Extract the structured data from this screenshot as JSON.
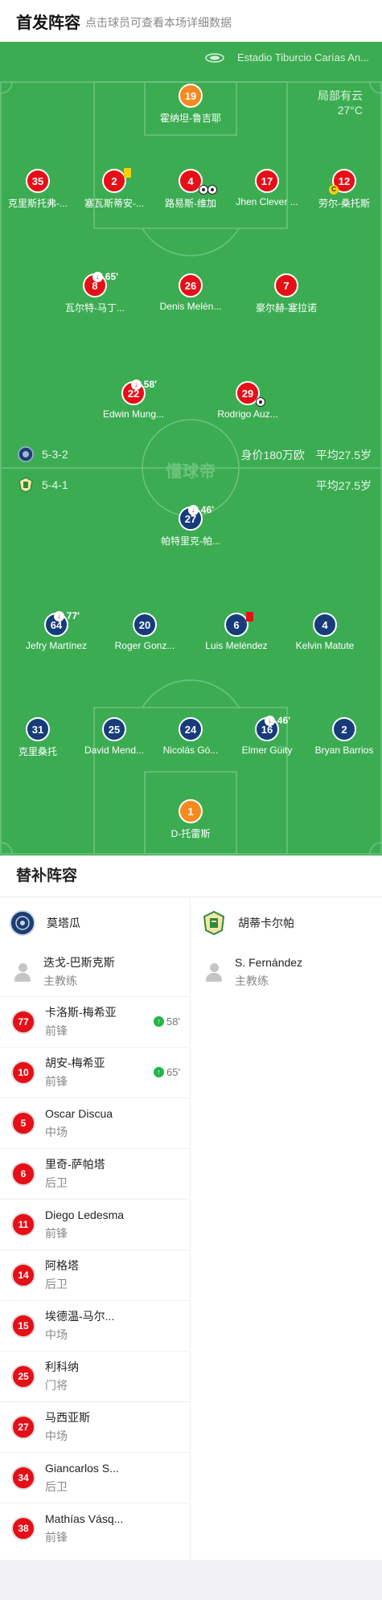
{
  "header": {
    "title": "首发阵容",
    "subtitle": "点击球员可查看本场详细数据"
  },
  "pitch": {
    "stadium": "Estadio Tiburcio Carías An...",
    "weather": "局部有云",
    "temperature": "27°C",
    "watermark": "懂球帝",
    "home_team": {
      "formation": "5-3-2",
      "value": "身价180万欧",
      "avg_age": "平均27.5岁",
      "crest_color": "#1d3e73"
    },
    "away_team": {
      "formation": "5-4-1",
      "avg_age": "平均27.5岁",
      "crest_color": "#2e8b3a"
    },
    "home_players": [
      {
        "num": "19",
        "name": "霍纳坦-鲁吉耶",
        "gk": true
      },
      {
        "num": "35",
        "name": "克里斯托弗-..."
      },
      {
        "num": "2",
        "name": "塞瓦斯蒂安-..."
      },
      {
        "num": "4",
        "name": "路易斯-维加"
      },
      {
        "num": "17",
        "name": "Jhen Clever ..."
      },
      {
        "num": "12",
        "name": "劳尔-桑托斯"
      },
      {
        "num": "8",
        "name": "瓦尔特-马丁...",
        "sub": "65'"
      },
      {
        "num": "26",
        "name": "Denis Melén..."
      },
      {
        "num": "7",
        "name": "豪尔赫-塞拉诺"
      },
      {
        "num": "22",
        "name": "Edwin Mung...",
        "sub": "58'"
      },
      {
        "num": "29",
        "name": "Rodrigo Auz..."
      }
    ],
    "away_players": [
      {
        "num": "27",
        "name": "帕特里克-帕...",
        "sub": "46'"
      },
      {
        "num": "64",
        "name": "Jefry Martínez",
        "sub": "77'"
      },
      {
        "num": "20",
        "name": "Roger Gonz..."
      },
      {
        "num": "6",
        "name": "Luis Meléndez"
      },
      {
        "num": "4",
        "name": "Kelvin Matute"
      },
      {
        "num": "31",
        "name": "克里桑托"
      },
      {
        "num": "25",
        "name": "David Mend..."
      },
      {
        "num": "24",
        "name": "Nicolás Gó..."
      },
      {
        "num": "16",
        "name": "Elmer Güity",
        "sub": "46'"
      },
      {
        "num": "2",
        "name": "Bryan Barrios"
      },
      {
        "num": "1",
        "name": "D-托雷斯",
        "gk": true
      }
    ]
  },
  "subs": {
    "title": "替补阵容",
    "home": {
      "team_name": "莫塔瓜",
      "coach": {
        "name": "迭戈-巴斯克斯",
        "role": "主教练"
      },
      "players": [
        {
          "num": "77",
          "name": "卡洛斯-梅希亚",
          "pos": "前锋",
          "in": "58'"
        },
        {
          "num": "10",
          "name": "胡安-梅希亚",
          "pos": "前锋",
          "in": "65'"
        },
        {
          "num": "5",
          "name": "Oscar Discua",
          "pos": "中场"
        },
        {
          "num": "6",
          "name": "里奇-萨帕塔",
          "pos": "后卫"
        },
        {
          "num": "11",
          "name": "Diego Ledesma",
          "pos": "前锋"
        },
        {
          "num": "14",
          "name": "阿格塔",
          "pos": "后卫"
        },
        {
          "num": "15",
          "name": "埃德温-马尔...",
          "pos": "中场"
        },
        {
          "num": "25",
          "name": "利科纳",
          "pos": "门将"
        },
        {
          "num": "27",
          "name": "马西亚斯",
          "pos": "中场"
        },
        {
          "num": "34",
          "name": "Giancarlos S...",
          "pos": "后卫"
        },
        {
          "num": "38",
          "name": "Mathías Vásq...",
          "pos": "前锋"
        }
      ]
    },
    "away": {
      "team_name": "胡蒂卡尔帕",
      "coach": {
        "name": "S. Fernández",
        "role": "主教练"
      }
    }
  }
}
